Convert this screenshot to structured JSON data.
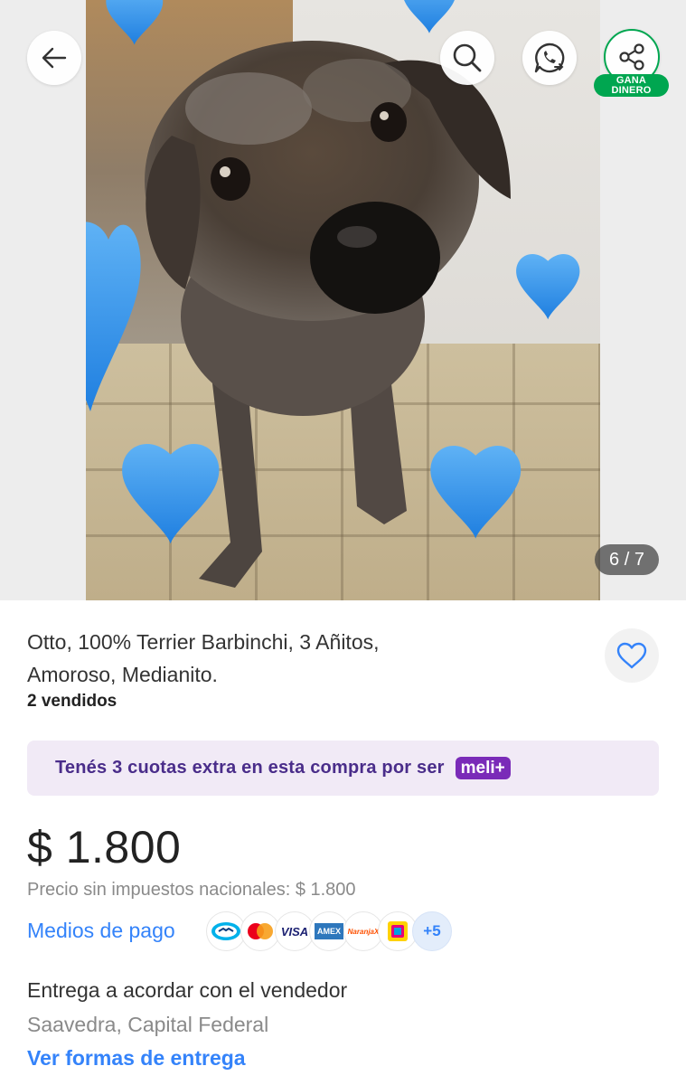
{
  "gallery": {
    "counter": "6 / 7",
    "share_badge_line1": "GANA",
    "share_badge_line2": "DINERO"
  },
  "product": {
    "title_line1": "Otto, 100% Terrier Barbinchi, 3 Añitos,",
    "title_line2": "Amoroso, Medianito.",
    "sold": "2 vendidos"
  },
  "promo": {
    "text": "Tenés 3 cuotas extra en esta compra por ser",
    "badge": "meli+"
  },
  "pricing": {
    "price": "$ 1.800",
    "note": "Precio sin impuestos nacionales: $ 1.800"
  },
  "payment": {
    "link": "Medios de pago",
    "methods": [
      "mercado-pago",
      "mastercard",
      "VISA",
      "AMEX",
      "NaranjaX",
      "tarjeta"
    ],
    "visa": "VISA",
    "amex": "AMEX",
    "naranja": "NaranjaX",
    "more": "+5"
  },
  "delivery": {
    "title": "Entrega a acordar con el vendedor",
    "location": "Saavedra, Capital Federal",
    "link": "Ver formas de entrega"
  },
  "colors": {
    "accent_blue": "#3483fa",
    "green": "#00a650",
    "meli_purple": "#7a2bb8"
  }
}
